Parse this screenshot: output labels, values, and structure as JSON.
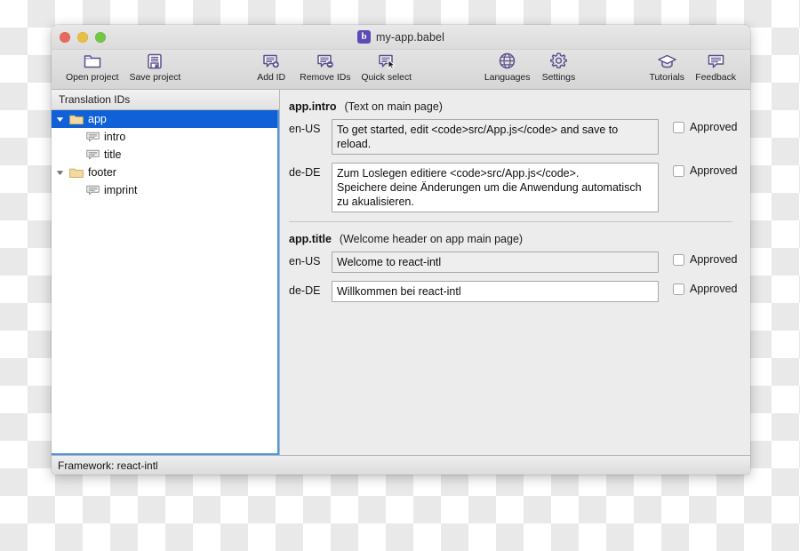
{
  "window": {
    "title": "my-app.babel",
    "app_icon": "babel-icon",
    "app_icon_glyph": "b",
    "traffic_lights": [
      {
        "name": "close-button",
        "color": "#e8685e"
      },
      {
        "name": "minimize-button",
        "color": "#e9c041"
      },
      {
        "name": "zoom-button",
        "color": "#72c744"
      }
    ]
  },
  "toolbar": {
    "left": [
      {
        "label": "Open project",
        "icon": "open-folder-icon"
      },
      {
        "label": "Save project",
        "icon": "floppy-disk-save-icon"
      }
    ],
    "center_left": [
      {
        "label": "Add ID",
        "icon": "speech-bubble-plus-icon"
      },
      {
        "label": "Remove IDs",
        "icon": "speech-bubble-minus-icon"
      },
      {
        "label": "Quick select",
        "icon": "speech-bubble-cursor-icon"
      }
    ],
    "center_right": [
      {
        "label": "Languages",
        "icon": "globe-icon"
      },
      {
        "label": "Settings",
        "icon": "gear-icon"
      }
    ],
    "right": [
      {
        "label": "Tutorials",
        "icon": "graduation-cap-icon"
      },
      {
        "label": "Feedback",
        "icon": "speech-bubble-icon"
      }
    ],
    "icon_color": "#5b4e8e"
  },
  "sidebar": {
    "header": "Translation IDs",
    "selection_color": "#1060d8",
    "items": [
      {
        "label": "app",
        "type": "folder",
        "depth": 1,
        "expanded": true,
        "selected": true,
        "icon": "folder-icon"
      },
      {
        "label": "intro",
        "type": "message",
        "depth": 2,
        "expanded": false,
        "selected": false,
        "icon": "speech-bubble-icon"
      },
      {
        "label": "title",
        "type": "message",
        "depth": 2,
        "expanded": false,
        "selected": false,
        "icon": "speech-bubble-icon"
      },
      {
        "label": "footer",
        "type": "folder",
        "depth": 1,
        "expanded": true,
        "selected": false,
        "icon": "folder-icon"
      },
      {
        "label": "imprint",
        "type": "message",
        "depth": 2,
        "expanded": false,
        "selected": false,
        "icon": "speech-bubble-icon"
      }
    ]
  },
  "main": {
    "entries": [
      {
        "id": "app.intro",
        "description": "(Text on main page)",
        "translations": [
          {
            "locale": "en-US",
            "value": "To get started, edit <code>src/App.js</code> and save to reload.",
            "shaded": true,
            "approved": false,
            "approved_label": "Approved"
          },
          {
            "locale": "de-DE",
            "value": "Zum Loslegen editiere <code>src/App.js</code>.\nSpeichere deine Änderungen um die Anwendung automatisch zu akualisieren.",
            "shaded": false,
            "approved": false,
            "approved_label": "Approved"
          }
        ]
      },
      {
        "id": "app.title",
        "description": "(Welcome header on app main page)",
        "translations": [
          {
            "locale": "en-US",
            "value": "Welcome to react-intl",
            "shaded": true,
            "approved": false,
            "approved_label": "Approved"
          },
          {
            "locale": "de-DE",
            "value": "Willkommen bei react-intl",
            "shaded": false,
            "approved": false,
            "approved_label": "Approved"
          }
        ]
      }
    ]
  },
  "statusbar": {
    "text": "Framework: react-intl"
  }
}
